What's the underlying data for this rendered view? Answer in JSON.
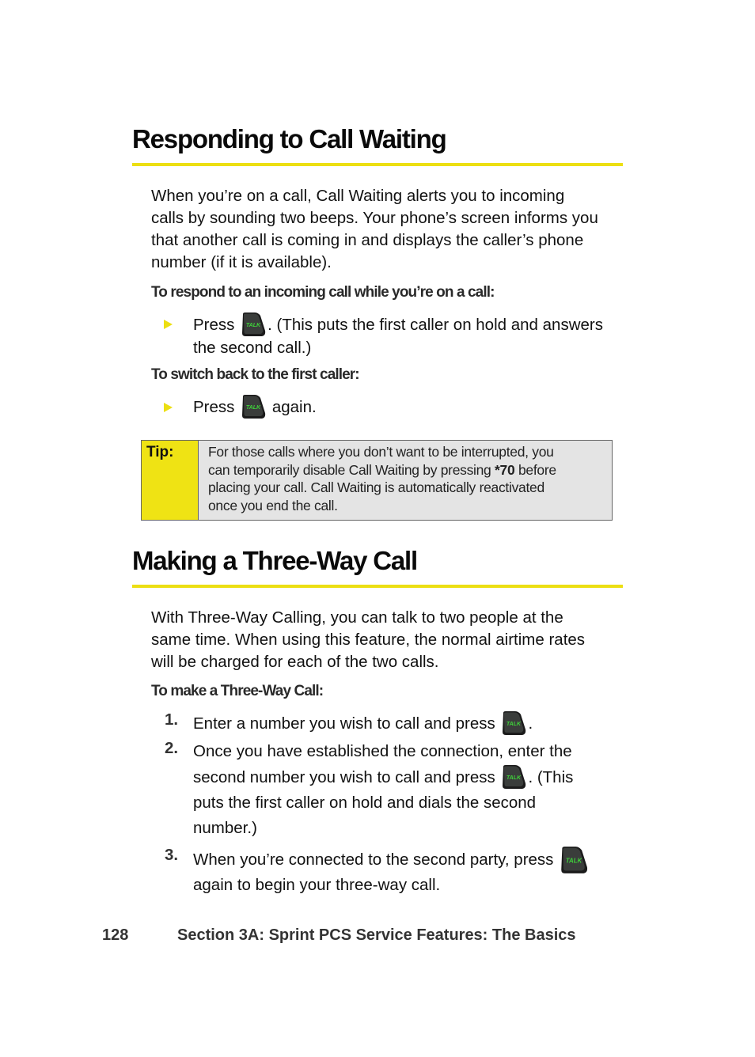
{
  "section1": {
    "title": "Responding to Call Waiting",
    "intro": "When you’re on a call, Call Waiting alerts you to incoming calls by sounding two beeps. Your phone’s screen informs you that another call is coming in and displays the caller’s phone number (if it is available).",
    "intro_lines": [
      "When you’re on a call, Call Waiting alerts you to incoming",
      "calls by sounding two beeps. Your phone’s screen informs you",
      "that another call is coming in and displays the caller’s phone",
      "number (if it is available)."
    ],
    "sub1": "To respond to an incoming call while you’re on a call:",
    "bullet1": {
      "pre": "Press",
      "post_line1": ". (This puts the first caller on hold and answers",
      "line2": "the second call.)"
    },
    "sub2": "To switch back to the first caller:",
    "bullet2": {
      "pre": "Press",
      "post": "again."
    }
  },
  "tip": {
    "label": "Tip:",
    "lines": [
      "For those calls where you don’t want to be interrupted, you",
      "can temporarily disable Call Waiting by pressing",
      "placing your call. Call Waiting is automatically reactivated",
      "once you end the call."
    ],
    "code": "*70",
    "after_code": "before"
  },
  "section2": {
    "title": "Making a Three-Way Call",
    "intro_lines": [
      "With Three-Way Calling, you can talk to two people at the",
      "same time. When using this feature, the normal airtime rates",
      "will be charged for each of the two calls."
    ],
    "sub": "To make a Three-Way Call:",
    "steps": [
      {
        "num": "1.",
        "pre": "Enter a number you wish to call and press",
        "post": "."
      },
      {
        "num": "2.",
        "line1": "Once you have established the connection, enter the",
        "pre": "second number you wish to call and press",
        "post": ". (This",
        "line3": "puts the first caller on hold and dials the second",
        "line4": "number.)"
      },
      {
        "num": "3.",
        "pre": "When you’re connected to the second party, press",
        "line2": "again to begin your three-way call."
      }
    ]
  },
  "icons": {
    "talk_key_label": "TALK"
  },
  "colors": {
    "accent_yellow": "#ecdf12",
    "tip_bg": "#e4e4e4",
    "talk_green": "#3fd23a"
  },
  "footer": {
    "page_number": "128",
    "section": "Section 3A: Sprint PCS Service Features: The Basics"
  }
}
